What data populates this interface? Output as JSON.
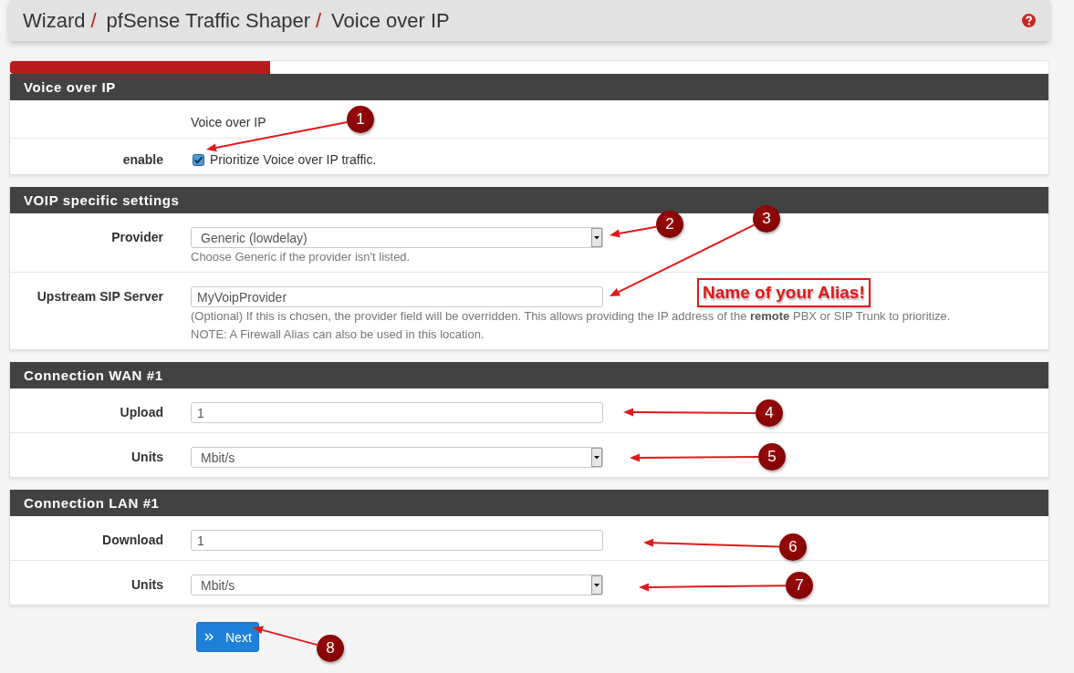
{
  "header": {
    "breadcrumb": [
      {
        "label": "Wizard",
        "separator": "/"
      },
      {
        "label": "pfSense Traffic Shaper",
        "separator": "/"
      },
      {
        "label": "Voice over IP"
      }
    ]
  },
  "progress": {
    "level": 0.25
  },
  "sections": [
    {
      "title": "Voice over IP",
      "rows": [
        {
          "kind": "text",
          "value": "Voice over IP"
        },
        {
          "kind": "checkbox",
          "label": "enable",
          "checked": true,
          "text": "Prioritize Voice over IP traffic."
        }
      ]
    },
    {
      "title": "VOIP specific settings",
      "rows": [
        {
          "kind": "select",
          "label": "Provider",
          "value": "Generic (lowdelay)",
          "help": [
            "Choose Generic if the provider isn't listed."
          ]
        },
        {
          "kind": "input",
          "label": "Upstream SIP Server",
          "value": "MyVoipProvider",
          "help": [
            "(Optional) If this is chosen, the provider field will be overridden. This allows providing the IP address of the **remote** PBX or SIP Trunk to prioritize.",
            "NOTE: A Firewall Alias can also be used in this location."
          ]
        }
      ]
    },
    {
      "title": "Connection WAN #1",
      "rows": [
        {
          "kind": "input",
          "label": "Upload",
          "value": "1"
        },
        {
          "kind": "select",
          "label": "Units",
          "value": "Mbit/s"
        }
      ]
    },
    {
      "title": "Connection LAN #1",
      "rows": [
        {
          "kind": "input",
          "label": "Download",
          "value": "1"
        },
        {
          "kind": "select",
          "label": "Units",
          "value": "Mbit/s"
        }
      ]
    }
  ],
  "next_button": {
    "label": "Next"
  },
  "annotations": {
    "callouts": [
      {
        "number": "1"
      },
      {
        "number": "2"
      },
      {
        "number": "3"
      },
      {
        "number": "4"
      },
      {
        "number": "5"
      },
      {
        "number": "6"
      },
      {
        "number": "7"
      },
      {
        "number": "8"
      }
    ],
    "note": "Name of your Alias!"
  }
}
